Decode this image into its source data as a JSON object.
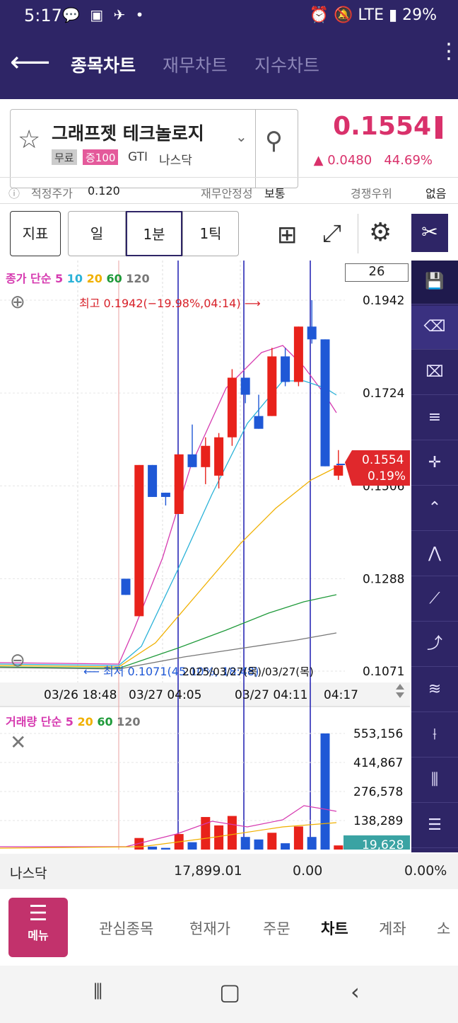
{
  "status_bar": {
    "time": "5:17",
    "battery": "29%",
    "network": "LTE"
  },
  "app_bar": {
    "tabs": [
      {
        "label": "종목차트",
        "active": true
      },
      {
        "label": "재무차트",
        "active": false
      },
      {
        "label": "지수차트",
        "active": false
      }
    ]
  },
  "stock": {
    "name": "그래프젯 테크놀로지",
    "tags": [
      "무료",
      "증100",
      "GTI",
      "나스닥"
    ],
    "price": "0.1554",
    "change": "▲ 0.0480",
    "change_pct": "44.69%"
  },
  "info": {
    "fair_label": "적정주가",
    "fair_value": "0.120",
    "stability_label": "재무안정성",
    "stability_value": "보통",
    "comp_label": "경쟁우위",
    "comp_value": "없음"
  },
  "toolbar": {
    "indicator": "지표",
    "day": "일",
    "minute": "1분",
    "tick": "1틱"
  },
  "chart": {
    "legend_price": "종가 단순",
    "legend_price_periods": [
      "5",
      "10",
      "20",
      "60",
      "120"
    ],
    "period_box": "26",
    "high_label": "최고 0.1942(−19.98%,04:14) ⟶",
    "low_label": "⟵ 최저 0.1071(45.10%, 18:48)",
    "price_ticks": [
      "0.1942",
      "0.1724",
      "0.1506",
      "0.1288",
      "0.1071"
    ],
    "current_price": "0.1554",
    "current_pct": "0.19%",
    "time_labels": [
      "03/26 18:48",
      "03/27 04:05",
      "03/27 04:11",
      "04:17"
    ],
    "overlay_dates": "2025/03/27(목)/03/27(목)",
    "legend_volume": "거래량 단순",
    "legend_volume_periods": [
      "5",
      "20",
      "60",
      "120"
    ],
    "volume_ticks": [
      "553,156",
      "414,867",
      "276,578",
      "138,289"
    ],
    "current_volume": "19,628",
    "colors": {
      "up": "#e8221b",
      "down": "#1f58d6",
      "ma5": "#d63ab0",
      "ma10": "#2ab2d8",
      "ma20": "#f0b000",
      "ma60": "#1f9a3a",
      "ma120": "#777777"
    }
  },
  "chart_data": {
    "type": "candlestick",
    "candles": [
      {
        "o": 0.1288,
        "h": 0.1288,
        "l": 0.125,
        "c": 0.125,
        "v": 0
      },
      {
        "o": 0.12,
        "h": 0.1555,
        "l": 0.12,
        "c": 0.1555,
        "v": 55000
      },
      {
        "o": 0.1555,
        "h": 0.1555,
        "l": 0.148,
        "c": 0.148,
        "v": 14000
      },
      {
        "o": 0.149,
        "h": 0.149,
        "l": 0.146,
        "c": 0.148,
        "v": 8000
      },
      {
        "o": 0.144,
        "h": 0.158,
        "l": 0.144,
        "c": 0.158,
        "v": 74000
      },
      {
        "o": 0.158,
        "h": 0.165,
        "l": 0.155,
        "c": 0.155,
        "v": 35000
      },
      {
        "o": 0.155,
        "h": 0.162,
        "l": 0.151,
        "c": 0.16,
        "v": 155000
      },
      {
        "o": 0.153,
        "h": 0.163,
        "l": 0.15,
        "c": 0.162,
        "v": 115000
      },
      {
        "o": 0.162,
        "h": 0.178,
        "l": 0.16,
        "c": 0.176,
        "v": 160000
      },
      {
        "o": 0.176,
        "h": 0.176,
        "l": 0.17,
        "c": 0.172,
        "v": 60000
      },
      {
        "o": 0.167,
        "h": 0.172,
        "l": 0.164,
        "c": 0.164,
        "v": 48000
      },
      {
        "o": 0.167,
        "h": 0.183,
        "l": 0.167,
        "c": 0.181,
        "v": 80000
      },
      {
        "o": 0.181,
        "h": 0.183,
        "l": 0.174,
        "c": 0.175,
        "v": 30000
      },
      {
        "o": 0.175,
        "h": 0.188,
        "l": 0.174,
        "c": 0.188,
        "v": 110000
      },
      {
        "o": 0.188,
        "h": 0.1942,
        "l": 0.184,
        "c": 0.185,
        "v": 60000
      },
      {
        "o": 0.185,
        "h": 0.185,
        "l": 0.1552,
        "c": 0.1552,
        "v": 553156
      },
      {
        "o": 0.153,
        "h": 0.159,
        "l": 0.152,
        "c": 0.1554,
        "v": 19628
      }
    ],
    "price_range": [
      0.1071,
      0.1942
    ],
    "volume_range": [
      0,
      553156
    ]
  },
  "nasdaq": {
    "label": "나스닥",
    "value": "17,899.01",
    "change": "0.00",
    "pct": "0.00%"
  },
  "bottom_nav": {
    "menu": "메뉴",
    "items": [
      "관심종목",
      "현재가",
      "주문",
      "차트",
      "계좌",
      "소"
    ]
  }
}
